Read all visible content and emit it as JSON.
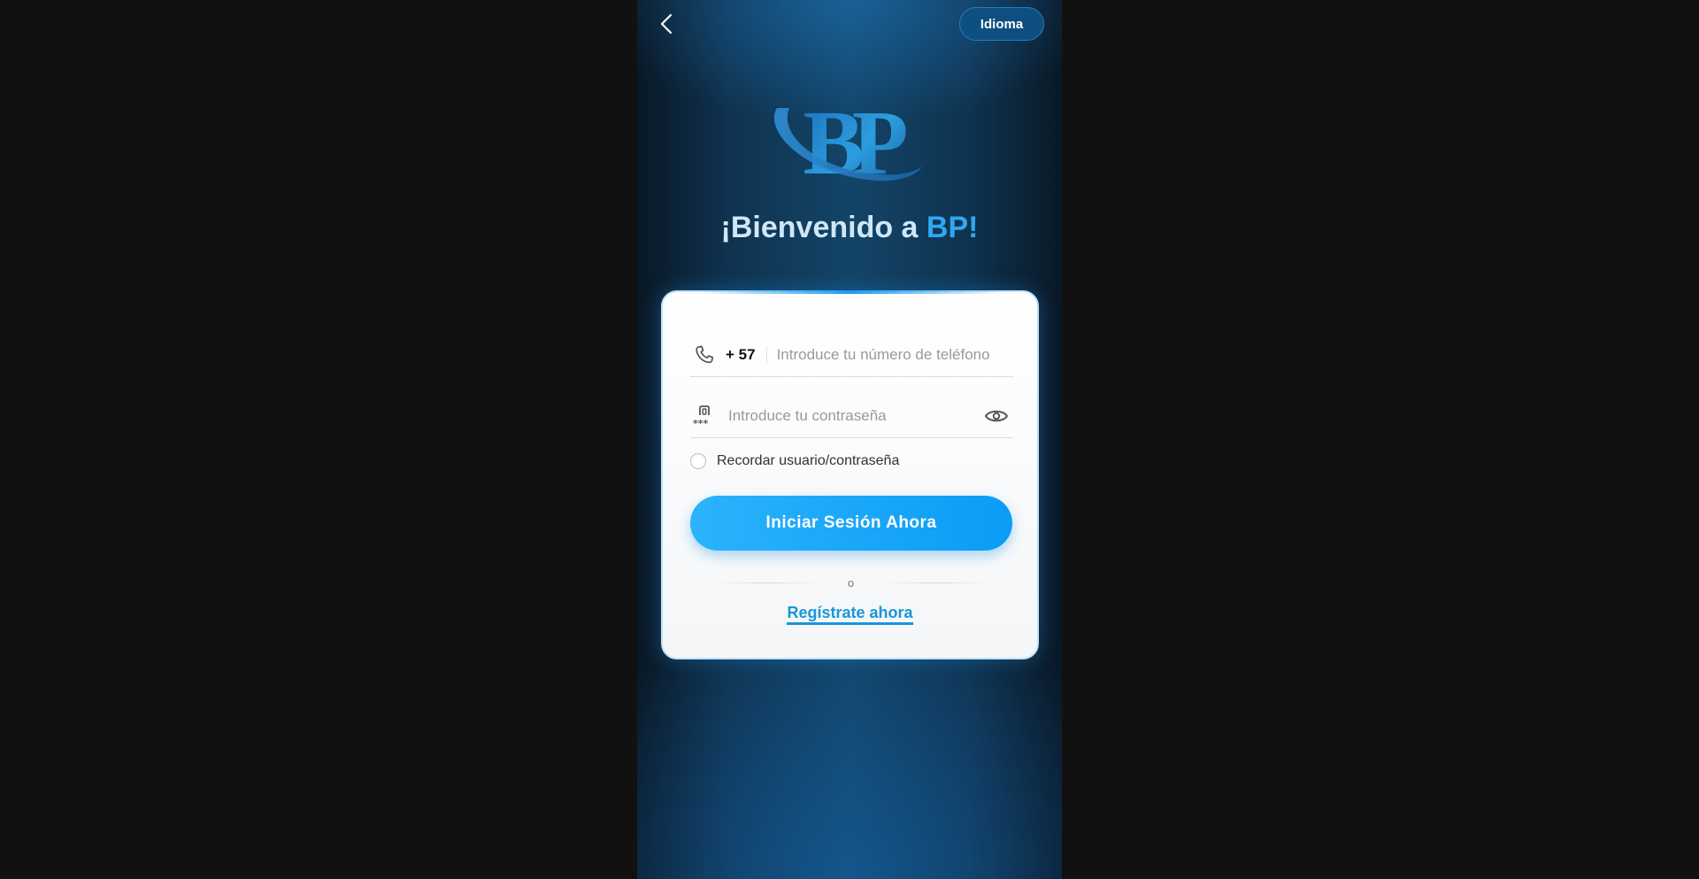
{
  "header": {
    "back_icon": "chevron-left-icon",
    "language_label": "Idioma"
  },
  "brand": {
    "logo_letters": "BP",
    "welcome_prefix": "¡Bienvenido a ",
    "welcome_accent": "BP!",
    "accent_color": "#2ea8f2"
  },
  "login_form": {
    "phone": {
      "icon": "phone-icon",
      "country_code": "+ 57",
      "placeholder": "Introduce tu número de teléfono",
      "value": ""
    },
    "password": {
      "icon": "password-lock-icon",
      "placeholder": "Introduce tu contraseña",
      "value": "",
      "toggle_icon": "eye-icon"
    },
    "remember_label": "Recordar usuario/contraseña",
    "remember_checked": false,
    "submit_label": "Iniciar Sesión Ahora",
    "button_color": "#0b9cf5",
    "divider_text": "o",
    "register_label": "Regístrate ahora",
    "link_color": "#1896d8"
  }
}
